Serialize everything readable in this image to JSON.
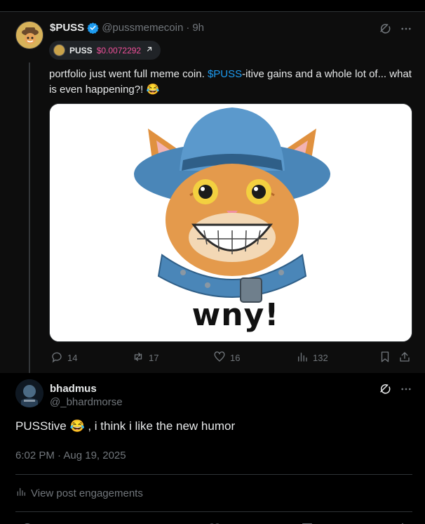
{
  "parent_post": {
    "display_name": "$PUSS",
    "handle": "@pussmemecoin",
    "separator": "·",
    "age": "9h",
    "cashtag": {
      "symbol": "PUSS",
      "price": "$0.0072292"
    },
    "text_before": "portfolio just went full meme coin. ",
    "text_link": "$PUSS",
    "text_after": "-itive gains and a whole lot of... what is even happening?! 😂",
    "media_caption": "wny!",
    "counts": {
      "replies": "14",
      "reposts": "17",
      "likes": "16",
      "views": "132"
    }
  },
  "reply_post": {
    "display_name": "bhadmus",
    "handle": "@_bhardmorse",
    "text": "PUSStive 😂 , i think i like the new humor",
    "timestamp": "6:02 PM · Aug 19, 2025",
    "engagements_label": "View post engagements"
  },
  "colors": {
    "accent": "#1d9bf0",
    "price": "#f0509a",
    "muted": "#71767b"
  },
  "icons": [
    "verified-badge-icon",
    "grok-icon",
    "more-icon",
    "arrow-up-right-icon",
    "reply-icon",
    "repost-icon",
    "like-icon",
    "views-icon",
    "bookmark-icon",
    "share-icon"
  ]
}
